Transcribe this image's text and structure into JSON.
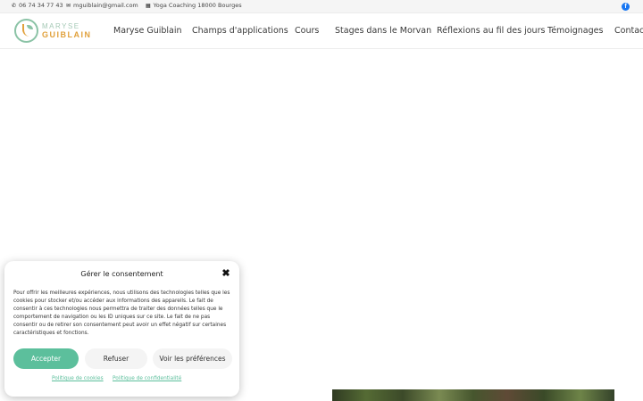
{
  "topbar": {
    "phone": "06 74 34 77 43",
    "email": "mguiblain@gmail.com",
    "location": "Yoga Coaching 18000 Bourges",
    "phone_icon": "phone-icon",
    "email_icon": "envelope-icon",
    "location_icon": "map-icon",
    "social_icon": "facebook-icon",
    "social_glyph": "f"
  },
  "logo": {
    "line1": "MARYSE",
    "line2": "GUIBLAIN"
  },
  "nav": {
    "items": [
      "Maryse Guiblain",
      "Champs d'applications",
      "Cours",
      "Stages dans le Morvan",
      "Réflexions au fil des jours",
      "Témoignages",
      "Contact"
    ]
  },
  "consent": {
    "title": "Gérer le consentement",
    "close_glyph": "✖",
    "body": "Pour offrir les meilleures expériences, nous utilisons des technologies telles que les cookies pour stocker et/ou accéder aux informations des appareils. Le fait de consentir à ces technologies nous permettra de traiter des données telles que le comportement de navigation ou les ID uniques sur ce site. Le fait de ne pas consentir ou de retirer son consentement peut avoir un effet négatif sur certaines caractéristiques et fonctions.",
    "accept_label": "Accepter",
    "refuse_label": "Refuser",
    "prefs_label": "Voir les préférences",
    "cookies_link": "Politique de cookies",
    "privacy_link": "Politique de confidentialité"
  },
  "colors": {
    "accent": "#5cbf9c",
    "logo_green": "#8bc3a6",
    "logo_orange": "#e1a13c",
    "facebook": "#1877f2"
  }
}
